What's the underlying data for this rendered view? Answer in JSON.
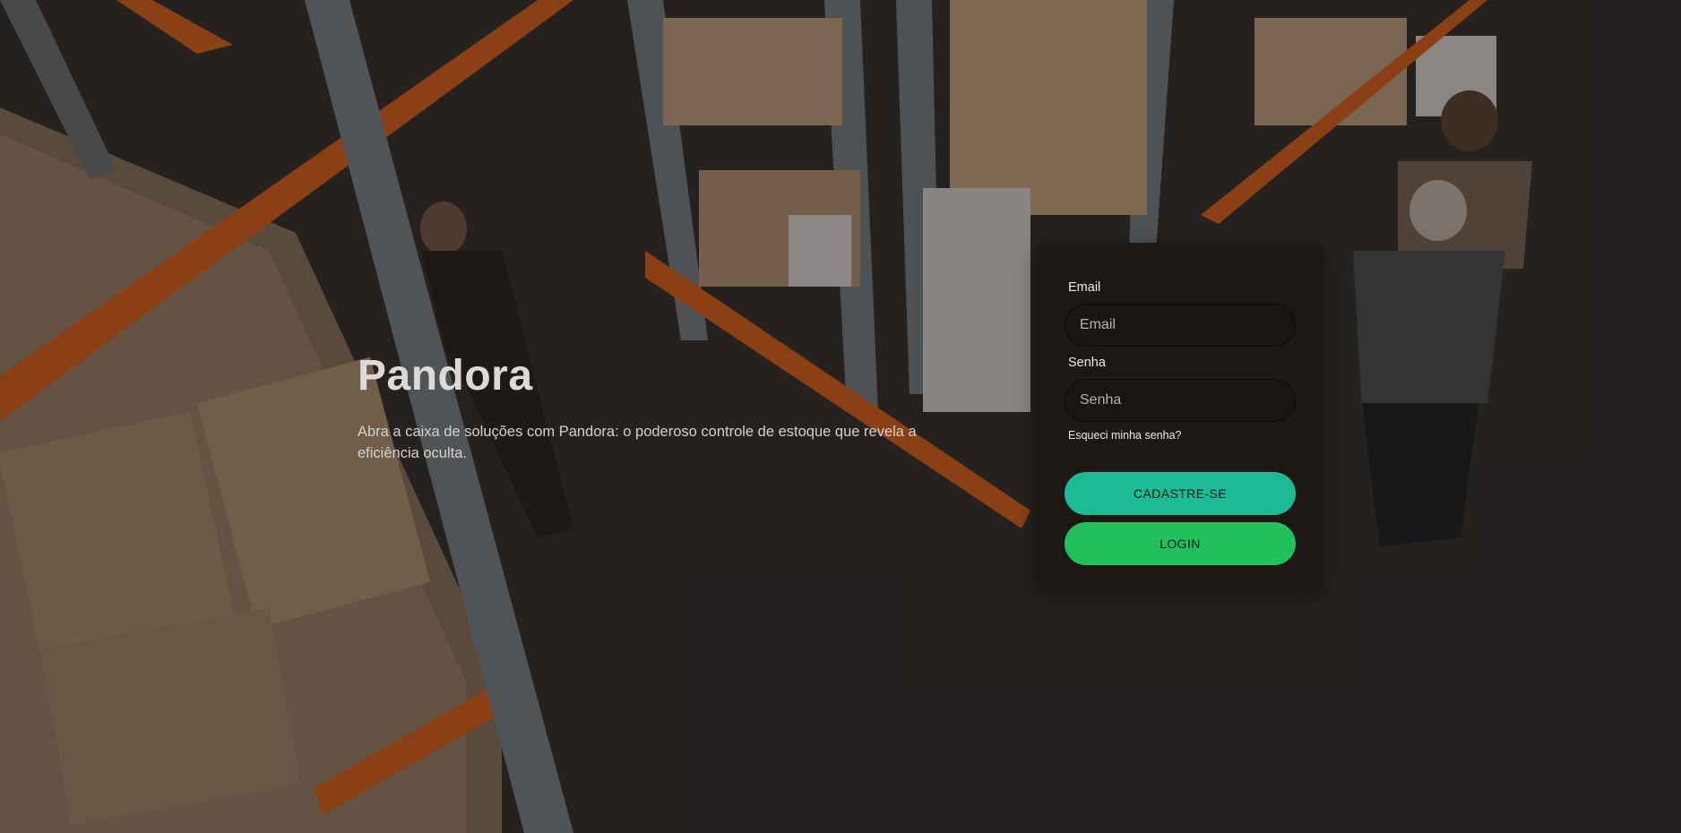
{
  "hero": {
    "title": "Pandora",
    "description": "Abra a caixa de soluções com Pandora: o poderoso controle de estoque que revela a eficiência oculta."
  },
  "login_form": {
    "email_label": "Email",
    "email_placeholder": "Email",
    "email_value": "",
    "password_label": "Senha",
    "password_placeholder": "Senha",
    "password_value": "",
    "forgot_password": "Esqueci minha senha?",
    "register_button": "CADASTRE-SE",
    "login_button": "LOGIN"
  },
  "colors": {
    "register_button": "#1dbb95",
    "login_button": "#22c05c",
    "card_background": "#1d1816"
  },
  "background": {
    "icon": "warehouse-photo"
  }
}
